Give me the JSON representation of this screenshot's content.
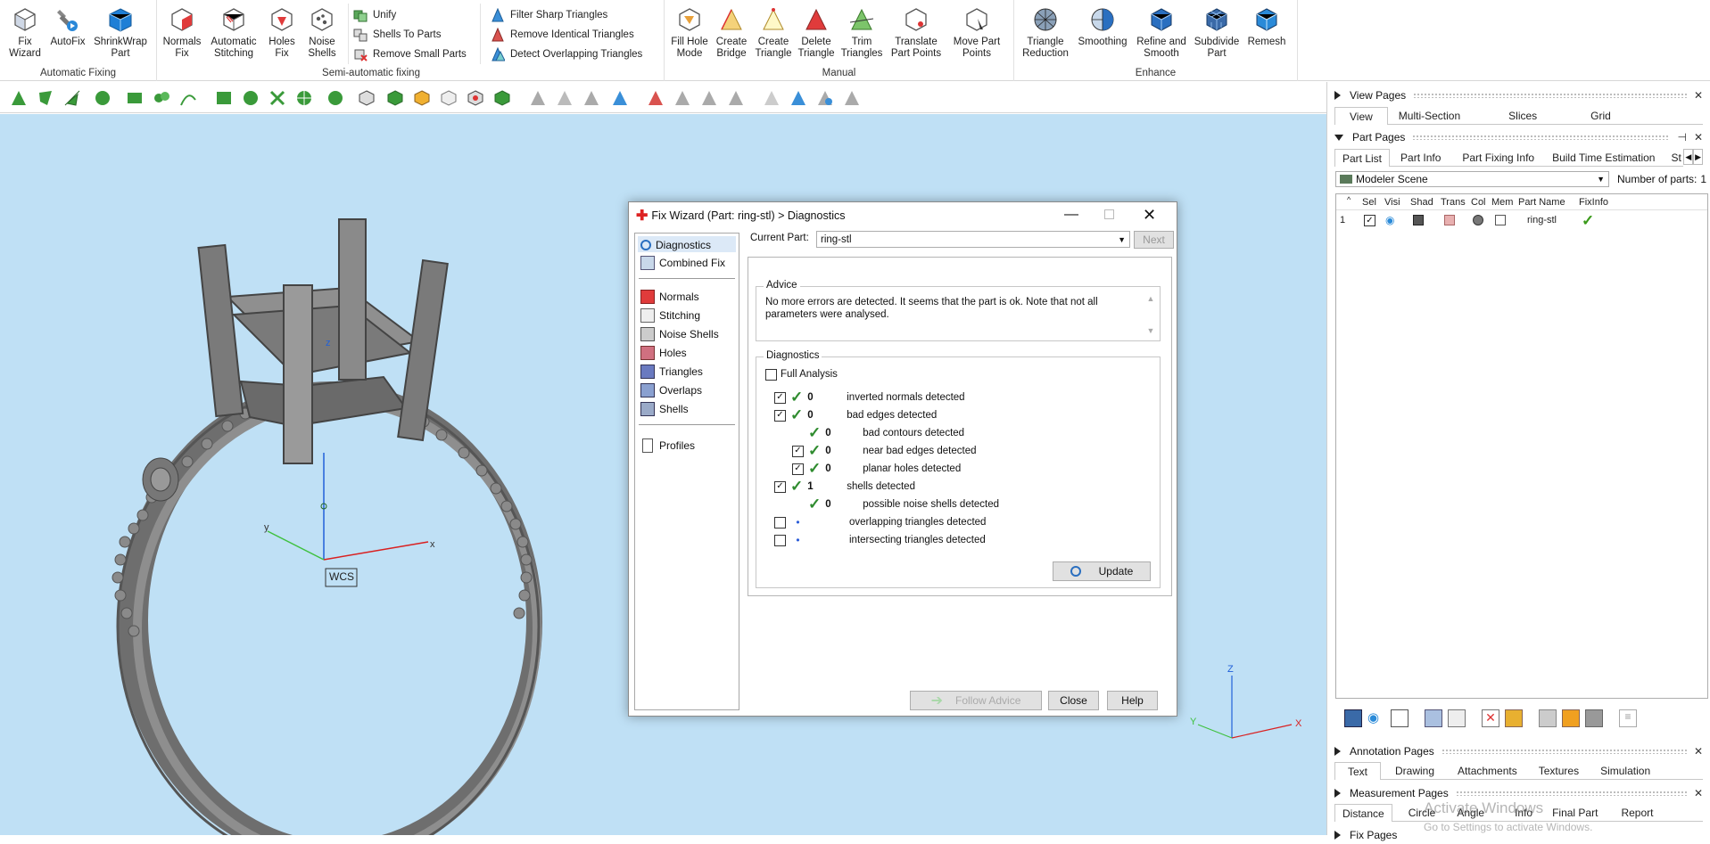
{
  "ribbon": {
    "automatic_fixing": {
      "label": "Automatic Fixing",
      "buttons": [
        {
          "label": "Fix\nWizard",
          "icon": "fix-wizard-icon"
        },
        {
          "label": "AutoFix",
          "icon": "autofix-icon"
        },
        {
          "label": "ShrinkWrap\nPart",
          "icon": "shrinkwrap-icon"
        }
      ]
    },
    "semi_automatic": {
      "label": "Semi-automatic fixing",
      "buttons": [
        {
          "label": "Normals\nFix"
        },
        {
          "label": "Automatic\nStitching"
        },
        {
          "label": "Holes\nFix"
        },
        {
          "label": "Noise\nShells"
        }
      ],
      "small_buttons": [
        "Unify",
        "Shells To Parts",
        "Remove Small Parts"
      ],
      "small_buttons2": [
        "Filter Sharp Triangles",
        "Remove Identical Triangles",
        "Detect Overlapping Triangles"
      ]
    },
    "manual": {
      "label": "Manual",
      "buttons": [
        {
          "label": "Fill Hole\nMode"
        },
        {
          "label": "Create\nBridge"
        },
        {
          "label": "Create\nTriangle"
        },
        {
          "label": "Delete\nTriangle"
        },
        {
          "label": "Trim\nTriangles"
        },
        {
          "label": "Translate\nPart Points"
        },
        {
          "label": "Move Part\nPoints"
        }
      ]
    },
    "enhance": {
      "label": "Enhance",
      "buttons": [
        {
          "label": "Triangle\nReduction"
        },
        {
          "label": "Smoothing"
        },
        {
          "label": "Refine and\nSmooth"
        },
        {
          "label": "Subdivide\nPart"
        },
        {
          "label": "Remesh"
        }
      ]
    }
  },
  "viewport": {
    "wcs_label": "WCS",
    "axes": {
      "x": "x",
      "y": "y",
      "z": "z"
    },
    "mini_axes": {
      "x": "X",
      "y": "Y",
      "z": "Z"
    }
  },
  "dialog": {
    "title": "Fix Wizard (Part: ring-stl) > Diagnostics",
    "nav": {
      "top": [
        "Diagnostics",
        "Combined Fix"
      ],
      "middle": [
        "Normals",
        "Stitching",
        "Noise Shells",
        "Holes",
        "Triangles",
        "Overlaps",
        "Shells"
      ],
      "bottom": [
        "Profiles"
      ]
    },
    "current_part_label": "Current Part:",
    "current_part_value": "ring-stl",
    "next_button": "Next",
    "advice_title": "Advice",
    "advice_text": "No more errors are detected. It seems that the part is ok. Note that not all parameters were analysed.",
    "diagnostics_title": "Diagnostics",
    "full_analysis_label": "Full Analysis",
    "rows": [
      {
        "checked": true,
        "status": "ok",
        "value": "0",
        "label": "inverted normals detected",
        "indent": 0
      },
      {
        "checked": true,
        "status": "ok",
        "value": "0",
        "label": "bad edges detected",
        "indent": 0
      },
      {
        "checked": null,
        "status": "ok",
        "value": "0",
        "label": "bad contours detected",
        "indent": 1
      },
      {
        "checked": true,
        "status": "ok",
        "value": "0",
        "label": "near bad edges detected",
        "indent": 1
      },
      {
        "checked": true,
        "status": "ok",
        "value": "0",
        "label": "planar holes detected",
        "indent": 1
      },
      {
        "checked": true,
        "status": "ok",
        "value": "1",
        "label": "shells detected",
        "indent": 0
      },
      {
        "checked": null,
        "status": "ok",
        "value": "0",
        "label": "possible noise shells detected",
        "indent": 1
      },
      {
        "checked": false,
        "status": "none",
        "value": "",
        "label": "overlapping triangles detected",
        "indent": 0
      },
      {
        "checked": false,
        "status": "none",
        "value": "",
        "label": "intersecting triangles detected",
        "indent": 0
      }
    ],
    "update_button": "Update",
    "follow_advice_button": "Follow Advice",
    "close_button": "Close",
    "help_button": "Help"
  },
  "right_panel": {
    "view_pages": {
      "title": "View Pages",
      "tabs": [
        "View",
        "Multi-Section",
        "Slices",
        "Grid"
      ]
    },
    "part_pages": {
      "title": "Part Pages",
      "tabs": [
        "Part List",
        "Part Info",
        "Part Fixing Info",
        "Build Time Estimation",
        "St"
      ],
      "scene_select": "Modeler Scene",
      "num_parts_label": "Number of parts:",
      "num_parts_value": "1",
      "columns": [
        "Sel",
        "Visi",
        "Shad",
        "Trans",
        "Col",
        "Mem",
        "Part Name",
        "FixInfo"
      ],
      "rows": [
        {
          "index": "1",
          "name": "ring-stl"
        }
      ]
    },
    "annotation_pages": {
      "title": "Annotation Pages",
      "tabs": [
        "Text",
        "Drawing",
        "Attachments",
        "Textures",
        "Simulation"
      ]
    },
    "measurement_pages": {
      "title": "Measurement Pages",
      "tabs": [
        "Distance",
        "Circle",
        "Angle",
        "Info",
        "Final Part",
        "Report"
      ]
    },
    "fix_pages_title": "Fix Pages"
  },
  "watermark": {
    "line1": "Activate Windows",
    "line2": "Go to Settings to activate Windows."
  },
  "colors": {
    "viewport_bg": "#bfe0f5",
    "ok_check": "#2e8b2e",
    "axis_x": "#d92020",
    "axis_y": "#3fc13f",
    "axis_z": "#2060d8"
  }
}
